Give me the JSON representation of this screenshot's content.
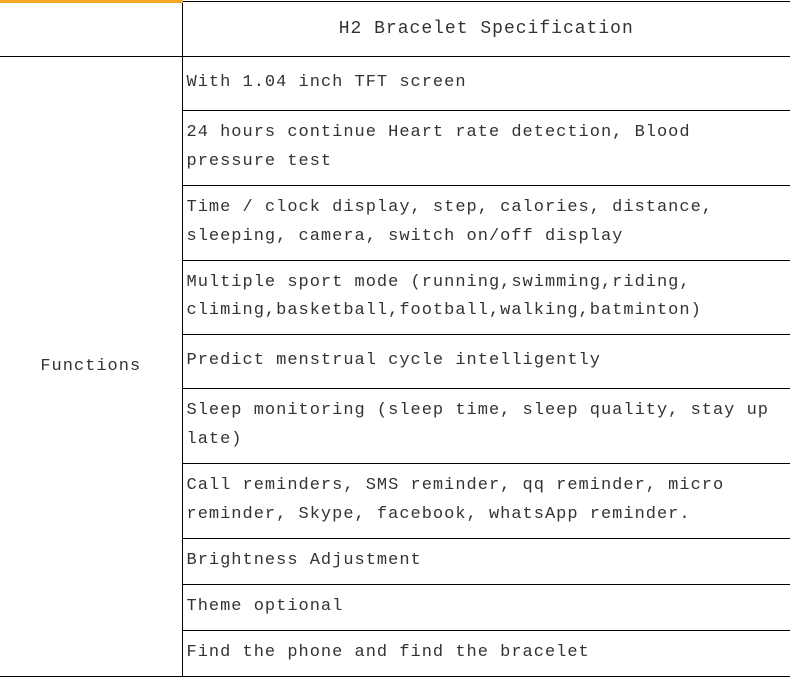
{
  "header": {
    "title": "H2 Bracelet Specification"
  },
  "section": {
    "label": "Functions"
  },
  "rows": [
    "With 1.04 inch TFT screen",
    "24 hours continue Heart rate detection, Blood pressure test",
    "Time / clock display, step, calories, distance, sleeping, camera, switch on/off display",
    "Multiple sport mode (running,swimming,riding, climing,basketball,football,walking,batminton)",
    "Predict menstrual cycle intelligently",
    "Sleep monitoring (sleep time, sleep quality, stay up late)",
    "Call reminders, SMS reminder, qq reminder, micro reminder, Skype, facebook, whatsApp reminder.",
    "Brightness Adjustment",
    "Theme optional",
    "Find the phone and find the bracelet"
  ]
}
